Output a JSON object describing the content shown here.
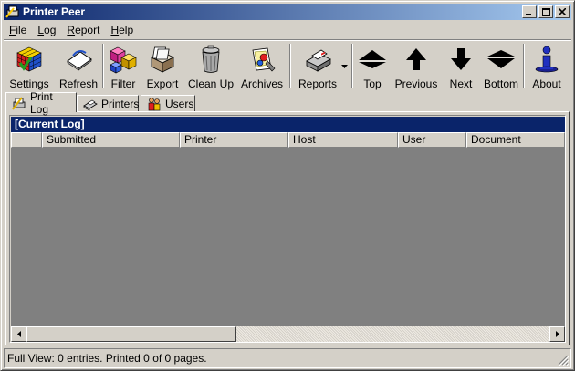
{
  "window": {
    "title": "Printer Peer"
  },
  "menu": [
    {
      "pre": "",
      "key": "F",
      "post": "ile"
    },
    {
      "pre": "",
      "key": "L",
      "post": "og"
    },
    {
      "pre": "",
      "key": "R",
      "post": "eport"
    },
    {
      "pre": "",
      "key": "H",
      "post": "elp"
    }
  ],
  "toolbar": {
    "settings": "Settings",
    "refresh": "Refresh",
    "filter": "Filter",
    "export": "Export",
    "cleanup": "Clean Up",
    "archives": "Archives",
    "reports": "Reports",
    "top": "Top",
    "previous": "Previous",
    "next": "Next",
    "bottom": "Bottom",
    "about": "About"
  },
  "tabs": {
    "print_log": "Print Log",
    "printers": "Printers",
    "users": "Users"
  },
  "log": {
    "title": "[Current Log]",
    "columns": [
      "",
      "Submitted",
      "Printer",
      "Host",
      "User",
      "Document"
    ]
  },
  "status": {
    "text": "Full View: 0 entries. Printed 0 of 0 pages."
  },
  "colors": {
    "title_dark": "#0a246a",
    "title_light": "#a6caf0",
    "face": "#d4d0c8",
    "grid": "#808080"
  },
  "icons": [
    "printer-peer-icon",
    "minimize-icon",
    "maximize-icon",
    "close-icon",
    "rubiks-cube-icon",
    "refresh-paper-icon",
    "shapes-filter-icon",
    "export-box-icon",
    "trash-can-icon",
    "archives-icon",
    "reports-printer-icon",
    "dropdown-arrow-icon",
    "top-arrow-icon",
    "up-arrow-icon",
    "down-arrow-icon",
    "bottom-arrow-icon",
    "about-info-icon"
  ]
}
